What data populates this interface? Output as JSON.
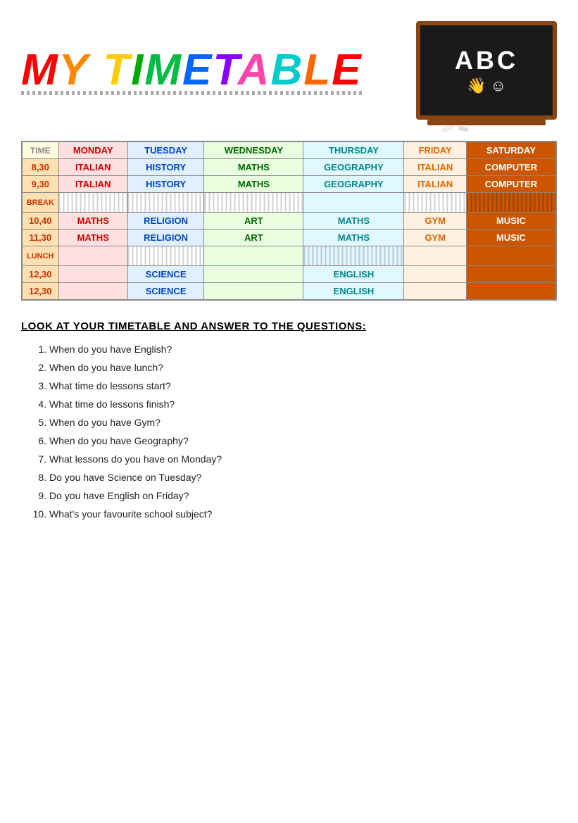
{
  "header": {
    "title": "MY TIMETABLE",
    "blackboard_text": "ABC"
  },
  "table": {
    "columns": [
      "TIME",
      "MONDAY",
      "TUESDAY",
      "WEDNESDAY",
      "THURSDAY",
      "FRIDAY",
      "SATURDAY"
    ],
    "rows": [
      {
        "time": "8,30",
        "monday": "ITALIAN",
        "tuesday": "HISTORY",
        "wednesday": "MATHS",
        "thursday": "GEOGRAPHY",
        "friday": "ITALIAN",
        "saturday": "COMPUTER"
      },
      {
        "time": "9,30",
        "monday": "ITALIAN",
        "tuesday": "HISTORY",
        "wednesday": "MATHS",
        "thursday": "GEOGRAPHY",
        "friday": "ITALIAN",
        "saturday": "COMPUTER"
      },
      {
        "time": "BREAK",
        "monday": "",
        "tuesday": "",
        "wednesday": "",
        "thursday": "",
        "friday": "",
        "saturday": ""
      },
      {
        "time": "10,40",
        "monday": "MATHS",
        "tuesday": "RELIGION",
        "wednesday": "ART",
        "thursday": "MATHS",
        "friday": "GYM",
        "saturday": "MUSIC"
      },
      {
        "time": "11,30",
        "monday": "MATHS",
        "tuesday": "RELIGION",
        "wednesday": "ART",
        "thursday": "MATHS",
        "friday": "GYM",
        "saturday": "MUSIC"
      },
      {
        "time": "LUNCH",
        "monday": "",
        "tuesday": "",
        "wednesday": "",
        "thursday": "",
        "friday": "",
        "saturday": ""
      },
      {
        "time": "12,30",
        "monday": "",
        "tuesday": "SCIENCE",
        "wednesday": "",
        "thursday": "ENGLISH",
        "friday": "",
        "saturday": ""
      },
      {
        "time": "12,30",
        "monday": "",
        "tuesday": "SCIENCE",
        "wednesday": "",
        "thursday": "ENGLISH",
        "friday": "",
        "saturday": ""
      }
    ]
  },
  "questions": {
    "title": "Look at your timetable and answer to the questions:",
    "items": [
      "When do you have English?",
      "When do you have lunch?",
      "What time do lessons start?",
      "What time do lessons finish?",
      "When do you have Gym?",
      "When do you have Geography?",
      "What lessons do you have on Monday?",
      "Do you have Science on Tuesday?",
      "Do you have English on Friday?",
      "What's your favourite school subject?"
    ]
  }
}
